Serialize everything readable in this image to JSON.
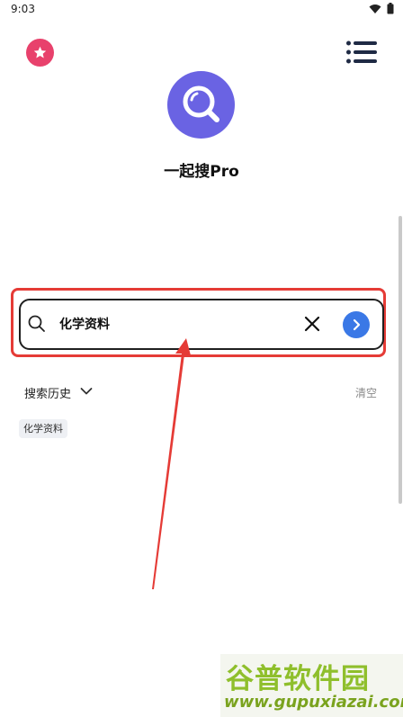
{
  "status_bar": {
    "time": "9:03",
    "icons": [
      "wifi-icon",
      "battery-icon"
    ]
  },
  "header": {
    "favorites_icon": "star-icon",
    "menu_icon": "menu-icon"
  },
  "app": {
    "name": "一起搜Pro",
    "logo_icon": "magnifier-logo-icon",
    "brand_color": "#6a63e3"
  },
  "search": {
    "value": "化学资料",
    "search_icon": "search-icon",
    "clear_icon": "close-icon",
    "go_icon": "chevron-right-icon",
    "go_color": "#3a78e6"
  },
  "history": {
    "label": "搜索历史",
    "toggle_icon": "chevron-down-icon",
    "clear_label": "清空",
    "items": [
      "化学资料"
    ]
  },
  "watermark": {
    "brand": "谷普软件园",
    "url": "www.gupuxiazai.com"
  },
  "colors": {
    "highlight": "#e53b36",
    "favorites": "#e8416c"
  }
}
